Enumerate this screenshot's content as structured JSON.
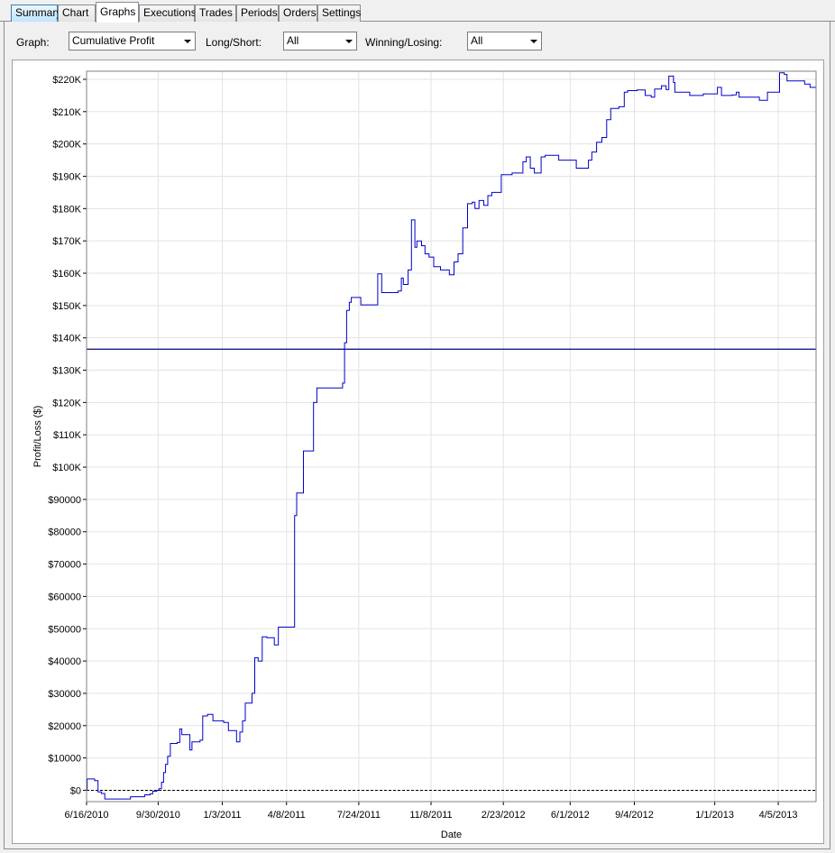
{
  "tabs": [
    {
      "label": "Summary",
      "state": "hover"
    },
    {
      "label": "Chart",
      "state": "normal"
    },
    {
      "label": "Graphs",
      "state": "active"
    },
    {
      "label": "Executions",
      "state": "normal"
    },
    {
      "label": "Trades",
      "state": "normal"
    },
    {
      "label": "Periods",
      "state": "normal"
    },
    {
      "label": "Orders",
      "state": "normal"
    },
    {
      "label": "Settings",
      "state": "normal"
    }
  ],
  "controls": {
    "graph_label": "Graph:",
    "graph_value": "Cumulative Profit",
    "longshort_label": "Long/Short:",
    "longshort_value": "All",
    "winlose_label": "Winning/Losing:",
    "winlose_value": "All"
  },
  "chart_data": {
    "type": "line",
    "xlabel": "Date",
    "ylabel": "Profit/Loss ($)",
    "x_ticks": [
      "6/16/2010",
      "9/30/2010",
      "1/3/2011",
      "4/8/2011",
      "7/24/2011",
      "11/8/2011",
      "2/23/2012",
      "6/1/2012",
      "9/4/2012",
      "1/1/2013",
      "4/5/2013"
    ],
    "x_range": [
      "6/16/2010",
      "5/31/2013"
    ],
    "y_ticks": [
      {
        "value": 0,
        "label": "$0"
      },
      {
        "value": 10000,
        "label": "$10000"
      },
      {
        "value": 20000,
        "label": "$20000"
      },
      {
        "value": 30000,
        "label": "$30000"
      },
      {
        "value": 40000,
        "label": "$40000"
      },
      {
        "value": 50000,
        "label": "$50000"
      },
      {
        "value": 60000,
        "label": "$60000"
      },
      {
        "value": 70000,
        "label": "$70000"
      },
      {
        "value": 80000,
        "label": "$80000"
      },
      {
        "value": 90000,
        "label": "$90000"
      },
      {
        "value": 100000,
        "label": "$100K"
      },
      {
        "value": 110000,
        "label": "$110K"
      },
      {
        "value": 120000,
        "label": "$120K"
      },
      {
        "value": 130000,
        "label": "$130K"
      },
      {
        "value": 140000,
        "label": "$140K"
      },
      {
        "value": 150000,
        "label": "$150K"
      },
      {
        "value": 160000,
        "label": "$160K"
      },
      {
        "value": 170000,
        "label": "$170K"
      },
      {
        "value": 180000,
        "label": "$180K"
      },
      {
        "value": 190000,
        "label": "$190K"
      },
      {
        "value": 200000,
        "label": "$200K"
      },
      {
        "value": 210000,
        "label": "$210K"
      },
      {
        "value": 220000,
        "label": "$220K"
      }
    ],
    "ylim": [
      -3500,
      222500
    ],
    "grid": true,
    "average_line": 136500,
    "zero_line": 0,
    "series": [
      {
        "color": "#0000cc",
        "points": [
          [
            "6/16/2010",
            0
          ],
          [
            "6/17/2010",
            3500
          ],
          [
            "6/28/2010",
            3000
          ],
          [
            "7/3/2010",
            -500
          ],
          [
            "7/8/2010",
            -1000
          ],
          [
            "7/13/2010",
            -2700
          ],
          [
            "8/20/2010",
            -2000
          ],
          [
            "9/10/2010",
            -1400
          ],
          [
            "9/18/2010",
            -1100
          ],
          [
            "9/22/2010",
            -300
          ],
          [
            "9/28/2010",
            0
          ],
          [
            "10/1/2010",
            500
          ],
          [
            "10/5/2010",
            2500
          ],
          [
            "10/8/2010",
            5500
          ],
          [
            "10/11/2010",
            8000
          ],
          [
            "10/14/2010",
            10500
          ],
          [
            "10/18/2010",
            14500
          ],
          [
            "10/28/2010",
            14800
          ],
          [
            "11/1/2010",
            19000
          ],
          [
            "11/4/2010",
            17200
          ],
          [
            "11/16/2010",
            12500
          ],
          [
            "11/19/2010",
            15000
          ],
          [
            "12/1/2010",
            15500
          ],
          [
            "12/5/2010",
            23000
          ],
          [
            "12/12/2010",
            23500
          ],
          [
            "12/20/2010",
            21500
          ],
          [
            "1/5/2011",
            21000
          ],
          [
            "1/12/2011",
            18500
          ],
          [
            "1/24/2011",
            15000
          ],
          [
            "1/29/2011",
            18000
          ],
          [
            "2/2/2011",
            21500
          ],
          [
            "2/6/2011",
            27000
          ],
          [
            "2/16/2011",
            30000
          ],
          [
            "2/20/2011",
            41000
          ],
          [
            "2/25/2011",
            40000
          ],
          [
            "3/3/2011",
            47500
          ],
          [
            "3/10/2011",
            47200
          ],
          [
            "3/21/2011",
            45000
          ],
          [
            "3/27/2011",
            50500
          ],
          [
            "4/20/2011",
            85000
          ],
          [
            "4/23/2011",
            92000
          ],
          [
            "5/3/2011",
            105000
          ],
          [
            "5/18/2011",
            120000
          ],
          [
            "5/23/2011",
            124500
          ],
          [
            "6/30/2011",
            126000
          ],
          [
            "7/3/2011",
            138500
          ],
          [
            "7/6/2011",
            148500
          ],
          [
            "7/10/2011",
            151000
          ],
          [
            "7/13/2011",
            152500
          ],
          [
            "7/27/2011",
            150200
          ],
          [
            "8/21/2011",
            159800
          ],
          [
            "8/27/2011",
            154000
          ],
          [
            "9/20/2011",
            154500
          ],
          [
            "9/25/2011",
            158500
          ],
          [
            "9/28/2011",
            156500
          ],
          [
            "10/5/2011",
            161000
          ],
          [
            "10/10/2011",
            176500
          ],
          [
            "10/15/2011",
            168000
          ],
          [
            "10/18/2011",
            170000
          ],
          [
            "10/25/2011",
            168500
          ],
          [
            "10/30/2011",
            166000
          ],
          [
            "11/5/2011",
            165000
          ],
          [
            "11/12/2011",
            162000
          ],
          [
            "11/22/2011",
            161000
          ],
          [
            "12/5/2011",
            159500
          ],
          [
            "12/12/2011",
            163500
          ],
          [
            "12/18/2011",
            166000
          ],
          [
            "12/25/2011",
            174000
          ],
          [
            "1/1/2012",
            181500
          ],
          [
            "1/8/2012",
            182000
          ],
          [
            "1/12/2012",
            180000
          ],
          [
            "1/18/2012",
            182500
          ],
          [
            "1/25/2012",
            181000
          ],
          [
            "1/31/2012",
            184000
          ],
          [
            "2/6/2012",
            185000
          ],
          [
            "2/20/2012",
            190500
          ],
          [
            "3/7/2012",
            191000
          ],
          [
            "3/23/2012",
            194500
          ],
          [
            "3/28/2012",
            196000
          ],
          [
            "4/3/2012",
            192500
          ],
          [
            "4/9/2012",
            191000
          ],
          [
            "4/19/2012",
            196000
          ],
          [
            "4/25/2012",
            196500
          ],
          [
            "5/15/2012",
            195000
          ],
          [
            "6/10/2012",
            192500
          ],
          [
            "6/28/2012",
            195000
          ],
          [
            "7/3/2012",
            197500
          ],
          [
            "7/10/2012",
            200500
          ],
          [
            "7/18/2012",
            202000
          ],
          [
            "7/25/2012",
            207500
          ],
          [
            "7/31/2012",
            211000
          ],
          [
            "8/12/2012",
            211500
          ],
          [
            "8/20/2012",
            216000
          ],
          [
            "8/25/2012",
            216500
          ],
          [
            "9/8/2012",
            216700
          ],
          [
            "9/20/2012",
            215000
          ],
          [
            "9/29/2012",
            214500
          ],
          [
            "10/4/2012",
            217000
          ],
          [
            "10/14/2012",
            218000
          ],
          [
            "10/21/2012",
            216800
          ],
          [
            "10/25/2012",
            221000
          ],
          [
            "11/1/2012",
            219000
          ],
          [
            "11/3/2012",
            216000
          ],
          [
            "11/25/2012",
            215000
          ],
          [
            "12/15/2012",
            215500
          ],
          [
            "1/5/2013",
            217500
          ],
          [
            "1/11/2013",
            215000
          ],
          [
            "1/27/2013",
            215200
          ],
          [
            "2/2/2013",
            216000
          ],
          [
            "2/6/2013",
            214500
          ],
          [
            "3/8/2013",
            213500
          ],
          [
            "3/20/2013",
            216000
          ],
          [
            "4/7/2013",
            222000
          ],
          [
            "4/14/2013",
            221500
          ],
          [
            "4/18/2013",
            219500
          ],
          [
            "5/14/2013",
            218500
          ],
          [
            "5/22/2013",
            217500
          ],
          [
            "5/31/2013",
            217000
          ]
        ]
      }
    ]
  }
}
